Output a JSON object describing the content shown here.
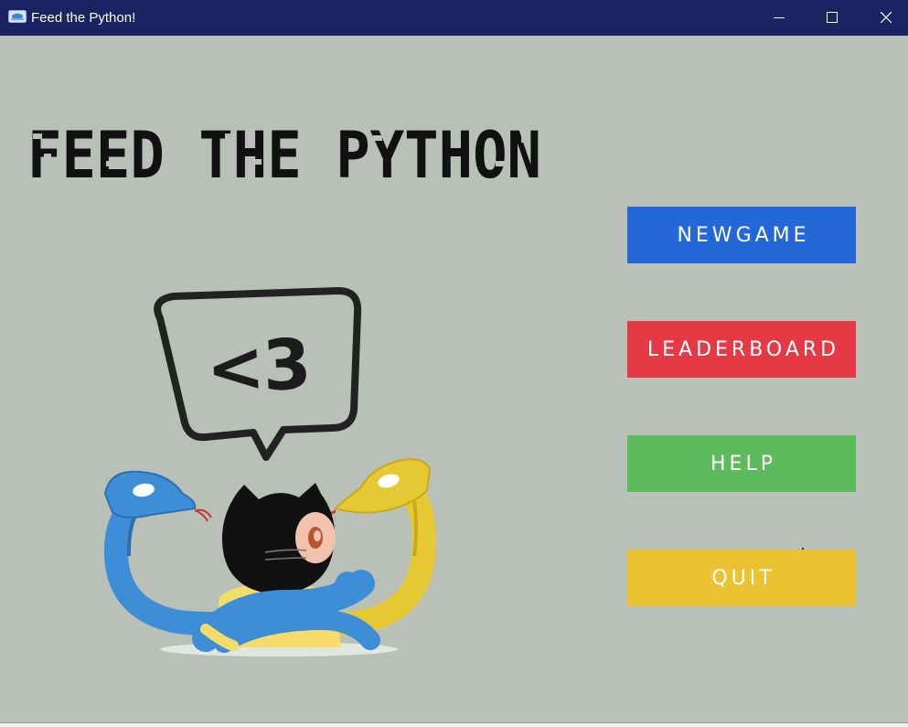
{
  "window": {
    "title": "Feed the Python!",
    "titlebar_color": "#1b2462",
    "background_color": "#b8c0b8",
    "controls": [
      "minimize-icon",
      "maximize-icon",
      "close-icon"
    ]
  },
  "game": {
    "title": "FEED THE PYTHON",
    "speech_bubble_text": "<3"
  },
  "menu": {
    "buttons": [
      {
        "label": "NEWGAME",
        "color": "#2368d6"
      },
      {
        "label": "LEADERBOARD",
        "color": "#e53a46"
      },
      {
        "label": "HELP",
        "color": "#5cbb5c"
      },
      {
        "label": "QUIT",
        "color": "#ebc232"
      }
    ]
  }
}
